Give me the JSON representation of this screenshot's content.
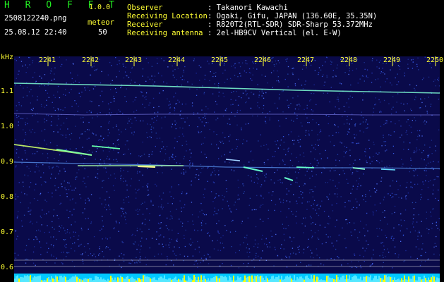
{
  "app": {
    "name": "H R O F F T",
    "version": "1.0.0"
  },
  "file": {
    "name": "2508122240.png",
    "datetime": "25.08.12 22:40"
  },
  "meteor": {
    "label": "meteor",
    "count": "50"
  },
  "info": [
    {
      "key": "Observer",
      "value": ": Takanori Kawachi"
    },
    {
      "key": "Receiving Location",
      "value": ": Ogaki, Gifu, JAPAN (136.60E, 35.35N)"
    },
    {
      "key": "Receiver",
      "value": ": R820T2(RTL-SDR) SDR-Sharp 53.372MHz"
    },
    {
      "key": "Receiving antenna",
      "value": ": 2el-HB9CV Vertical (el. E-W)"
    }
  ],
  "y_axis": {
    "unit": "kHz",
    "ticks": [
      "1.1",
      "1.0",
      "0.9",
      "0.8",
      "0.7",
      "0.6"
    ]
  },
  "x_axis": {
    "ticks": [
      "2241",
      "2242",
      "2243",
      "2244",
      "2245",
      "2246",
      "2247",
      "2248",
      "2249",
      "2250"
    ]
  },
  "colors": {
    "background": "#0a0a4a",
    "trace": "#7fffd4",
    "title": "#22ee22",
    "axis": "#ffff33",
    "text": "#ffffff"
  }
}
